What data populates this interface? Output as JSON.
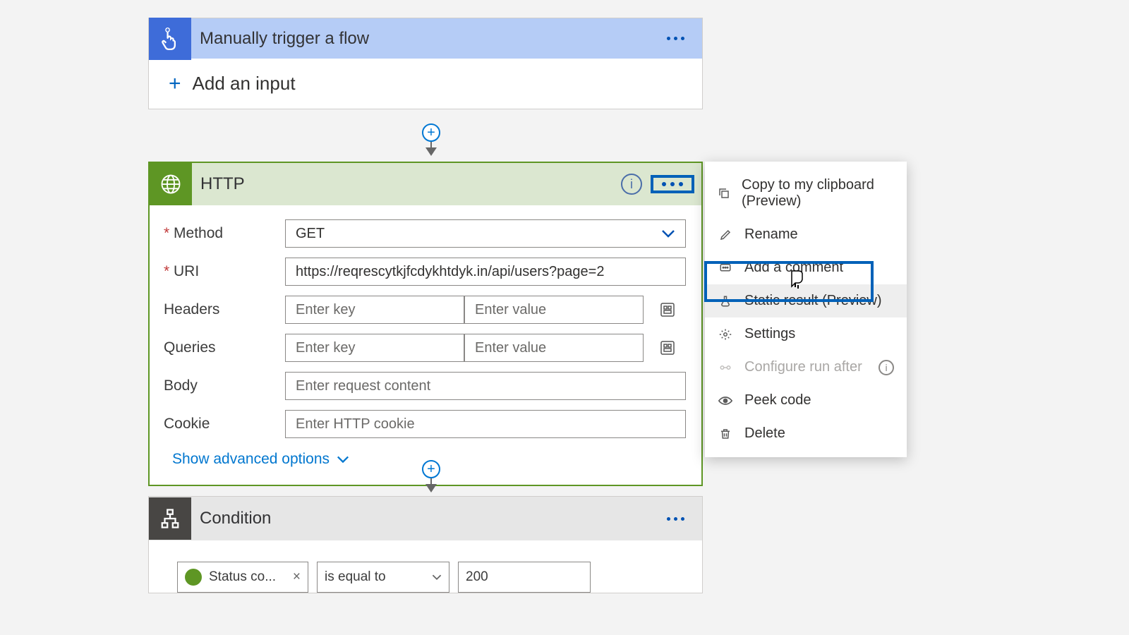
{
  "trigger": {
    "title": "Manually trigger a flow",
    "add_input": "Add an input"
  },
  "http": {
    "title": "HTTP",
    "method_label": "Method",
    "method_value": "GET",
    "uri_label": "URI",
    "uri_value": "https://reqrescytkjfcdykhtdyk.in/api/users?page=2",
    "headers_label": "Headers",
    "queries_label": "Queries",
    "key_placeholder": "Enter key",
    "value_placeholder": "Enter value",
    "body_label": "Body",
    "body_placeholder": "Enter request content",
    "cookie_label": "Cookie",
    "cookie_placeholder": "Enter HTTP cookie",
    "advanced": "Show advanced options"
  },
  "condition": {
    "title": "Condition",
    "token_label": "Status co...",
    "operator": "is equal to",
    "value": "200"
  },
  "menu": {
    "copy": "Copy to my clipboard (Preview)",
    "rename": "Rename",
    "comment": "Add a comment",
    "static": "Static result (Preview)",
    "settings": "Settings",
    "runafter": "Configure run after",
    "peek": "Peek code",
    "delete": "Delete"
  }
}
